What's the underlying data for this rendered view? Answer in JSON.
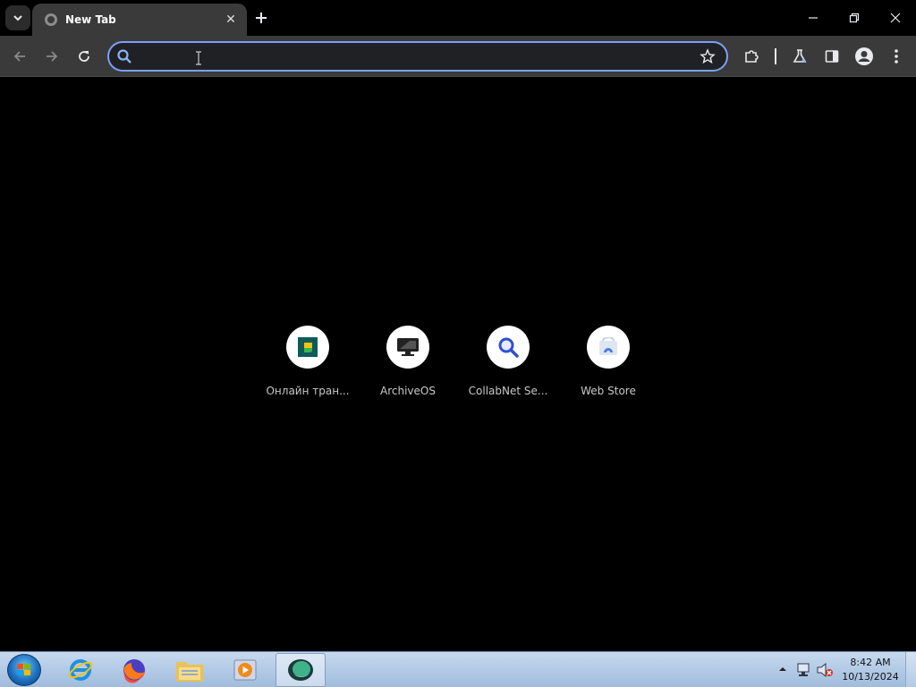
{
  "browser": {
    "tab": {
      "title": "New Tab"
    },
    "omnibox": {
      "value": "",
      "placeholder": ""
    }
  },
  "shortcuts": [
    {
      "label": "Онлайн тран...",
      "icon": "green-square-icon"
    },
    {
      "label": "ArchiveOS",
      "icon": "monitor-icon"
    },
    {
      "label": "CollabNet Se...",
      "icon": "magnifier-icon"
    },
    {
      "label": "Web Store",
      "icon": "web-store-icon"
    }
  ],
  "taskbar": {
    "apps": [
      "internet-explorer-icon",
      "firefox-icon",
      "file-explorer-icon",
      "media-player-icon",
      "chrome-app-icon"
    ],
    "clock": {
      "time": "8:42 AM",
      "date": "10/13/2024"
    }
  },
  "colors": {
    "omnibox_focus": "#7ca0f7",
    "toolbar": "#3a3a3a",
    "taskbar": "#b3cce8"
  }
}
